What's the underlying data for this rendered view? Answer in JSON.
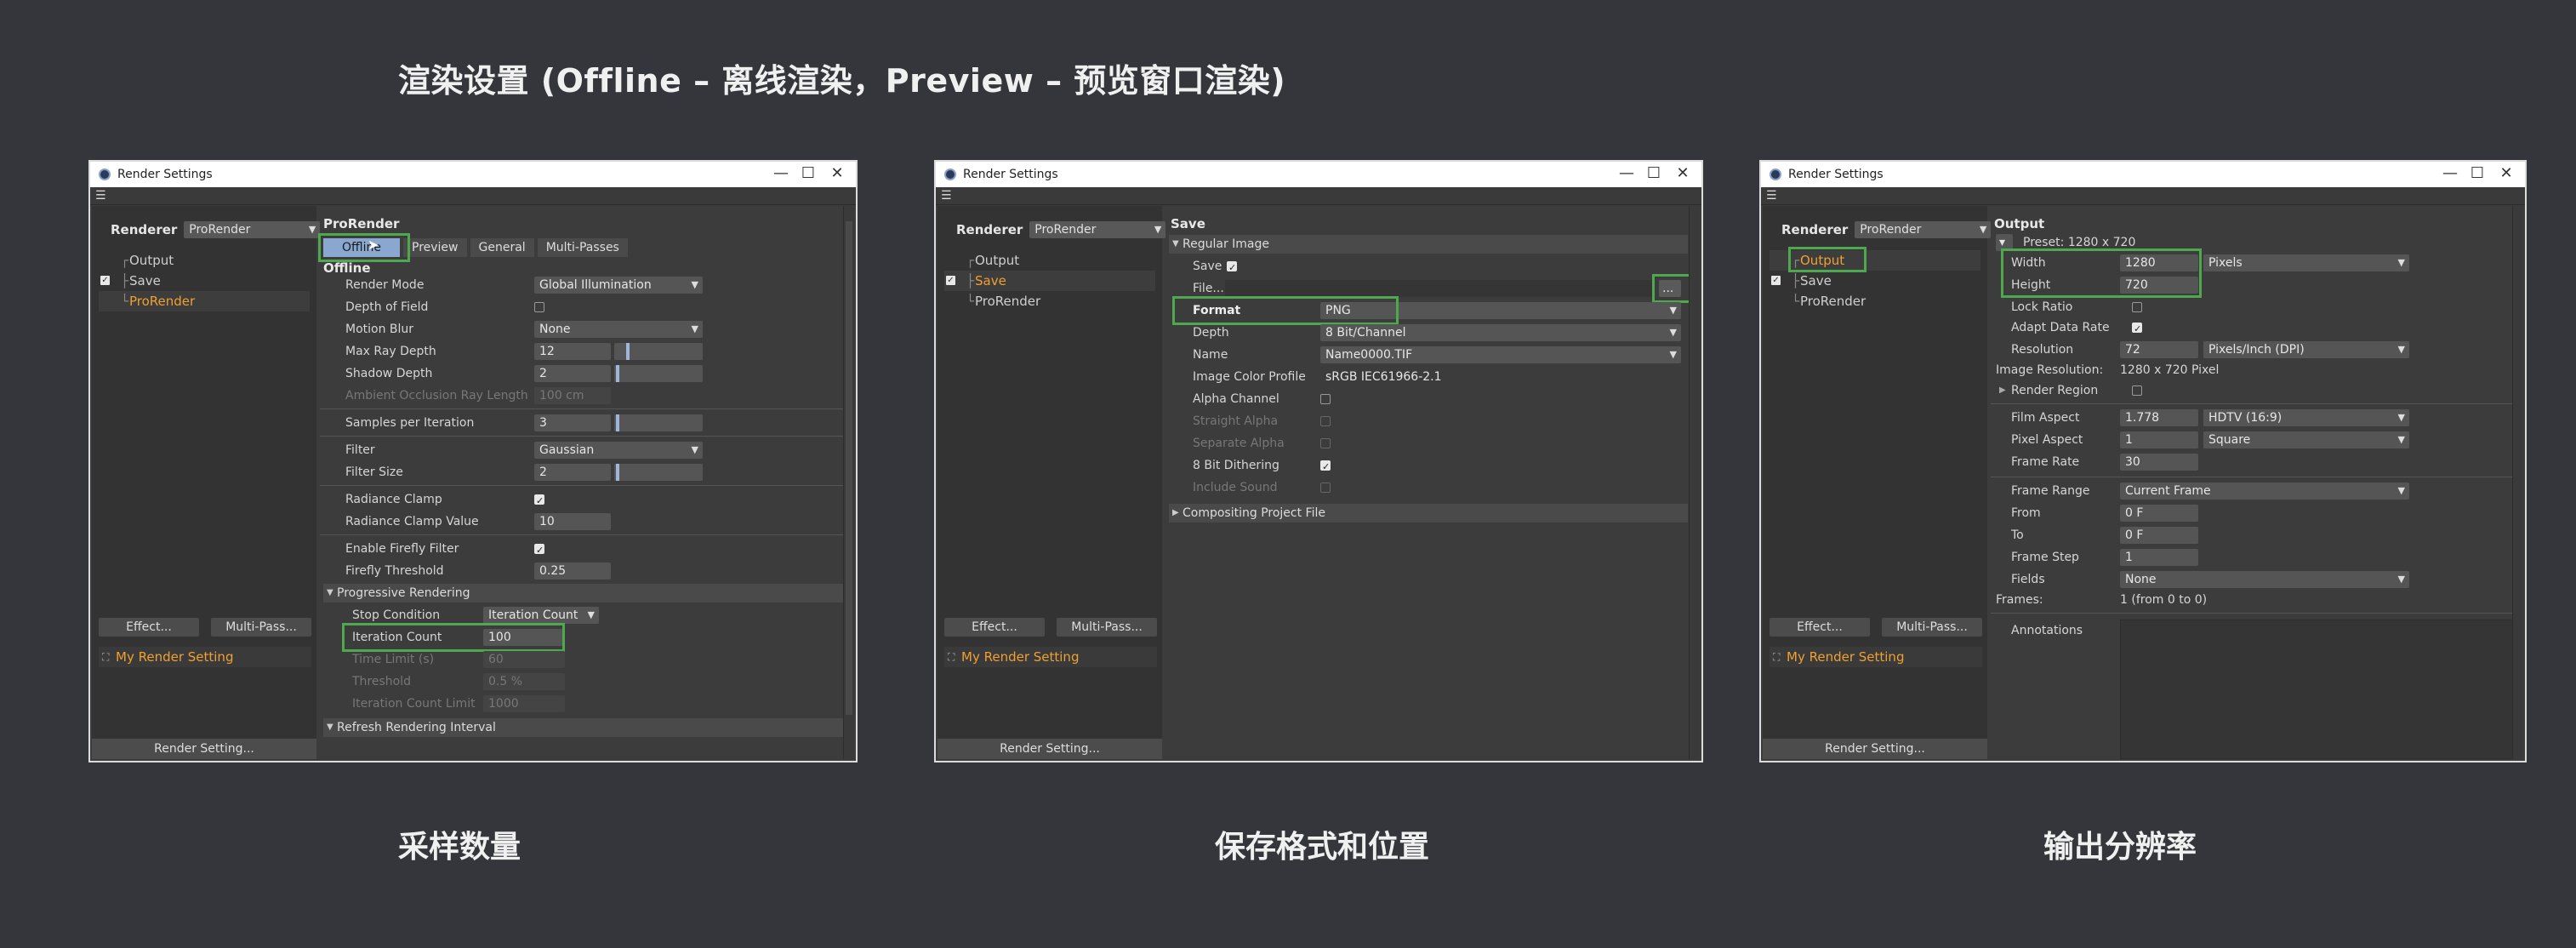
{
  "main_title": "渲染设置 (Offline – 离线渲染，Preview – 预览窗口渲染)",
  "captions": [
    "采样数量",
    "保存格式和位置",
    "输出分辨率"
  ],
  "window_title": "Render Settings",
  "window_controls": [
    "—",
    "☐",
    "✕"
  ],
  "renderer_label": "Renderer",
  "renderer_value": "ProRender",
  "tree": [
    "Output",
    "Save",
    "ProRender"
  ],
  "effect_button": "Effect...",
  "multipass_button": "Multi-Pass...",
  "my_render_setting": "My Render Setting",
  "render_setting_button": "Render Setting...",
  "highlight_color": "#4ea84e",
  "w1": {
    "title": "ProRender",
    "tabs": [
      "Offline",
      "Preview",
      "General",
      "Multi-Passes"
    ],
    "subtitle": "Offline",
    "render_mode": {
      "label": "Render Mode",
      "value": "Global Illumination"
    },
    "depth_of_field": {
      "label": "Depth of Field"
    },
    "motion_blur": {
      "label": "Motion Blur",
      "value": "None"
    },
    "max_ray_depth": {
      "label": "Max Ray Depth",
      "value": "12"
    },
    "shadow_depth": {
      "label": "Shadow Depth",
      "value": "2"
    },
    "ao_ray_length": {
      "label": "Ambient Occlusion Ray Length",
      "value": "100 cm"
    },
    "samples_per_iteration": {
      "label": "Samples per Iteration",
      "value": "3"
    },
    "filter": {
      "label": "Filter",
      "value": "Gaussian"
    },
    "filter_size": {
      "label": "Filter Size",
      "value": "2"
    },
    "radiance_clamp": {
      "label": "Radiance Clamp"
    },
    "radiance_clamp_value": {
      "label": "Radiance Clamp Value",
      "value": "10"
    },
    "enable_firefly": {
      "label": "Enable Firefly Filter"
    },
    "firefly_threshold": {
      "label": "Firefly Threshold",
      "value": "0.25"
    },
    "progressive": "Progressive Rendering",
    "stop_condition": {
      "label": "Stop Condition",
      "value": "Iteration Count"
    },
    "iteration_count": {
      "label": "Iteration Count",
      "value": "100"
    },
    "time_limit": {
      "label": "Time Limit (s)",
      "value": "60"
    },
    "threshold": {
      "label": "Threshold",
      "value": "0.5 %"
    },
    "iteration_limit": {
      "label": "Iteration Count Limit",
      "value": "1000"
    },
    "refresh": "Refresh Rendering Interval"
  },
  "w2": {
    "title": "Save",
    "regular_image": "Regular Image",
    "save": {
      "label": "Save"
    },
    "file": {
      "label": "File...",
      "button": "..."
    },
    "format": {
      "label": "Format",
      "value": "PNG"
    },
    "depth": {
      "label": "Depth",
      "value": "8 Bit/Channel"
    },
    "name": {
      "label": "Name",
      "value": "Name0000.TIF"
    },
    "color_profile": {
      "label": "Image Color Profile",
      "value": "sRGB IEC61966-2.1"
    },
    "alpha_channel": {
      "label": "Alpha Channel"
    },
    "straight_alpha": {
      "label": "Straight Alpha"
    },
    "separate_alpha": {
      "label": "Separate Alpha"
    },
    "dithering": {
      "label": "8 Bit Dithering"
    },
    "include_sound": {
      "label": "Include Sound"
    },
    "compositing": "Compositing Project File"
  },
  "w3": {
    "title": "Output",
    "preset": "Preset: 1280 x 720",
    "width": {
      "label": "Width",
      "value": "1280",
      "unit": "Pixels"
    },
    "height": {
      "label": "Height",
      "value": "720"
    },
    "lock_ratio": {
      "label": "Lock Ratio"
    },
    "adapt_data_rate": {
      "label": "Adapt Data Rate"
    },
    "resolution": {
      "label": "Resolution",
      "value": "72",
      "unit": "Pixels/Inch (DPI)"
    },
    "image_resolution": {
      "label": "Image Resolution:",
      "value": "1280 x 720 Pixel"
    },
    "render_region": {
      "label": "Render Region"
    },
    "film_aspect": {
      "label": "Film Aspect",
      "value": "1.778",
      "preset": "HDTV (16:9)"
    },
    "pixel_aspect": {
      "label": "Pixel Aspect",
      "value": "1",
      "preset": "Square"
    },
    "frame_rate": {
      "label": "Frame Rate",
      "value": "30"
    },
    "frame_range": {
      "label": "Frame Range",
      "value": "Current Frame"
    },
    "from": {
      "label": "From",
      "value": "0 F"
    },
    "to": {
      "label": "To",
      "value": "0 F"
    },
    "frame_step": {
      "label": "Frame Step",
      "value": "1"
    },
    "fields": {
      "label": "Fields",
      "value": "None"
    },
    "frames": {
      "label": "Frames:",
      "value": "1 (from 0 to 0)"
    },
    "annotations": {
      "label": "Annotations"
    }
  }
}
